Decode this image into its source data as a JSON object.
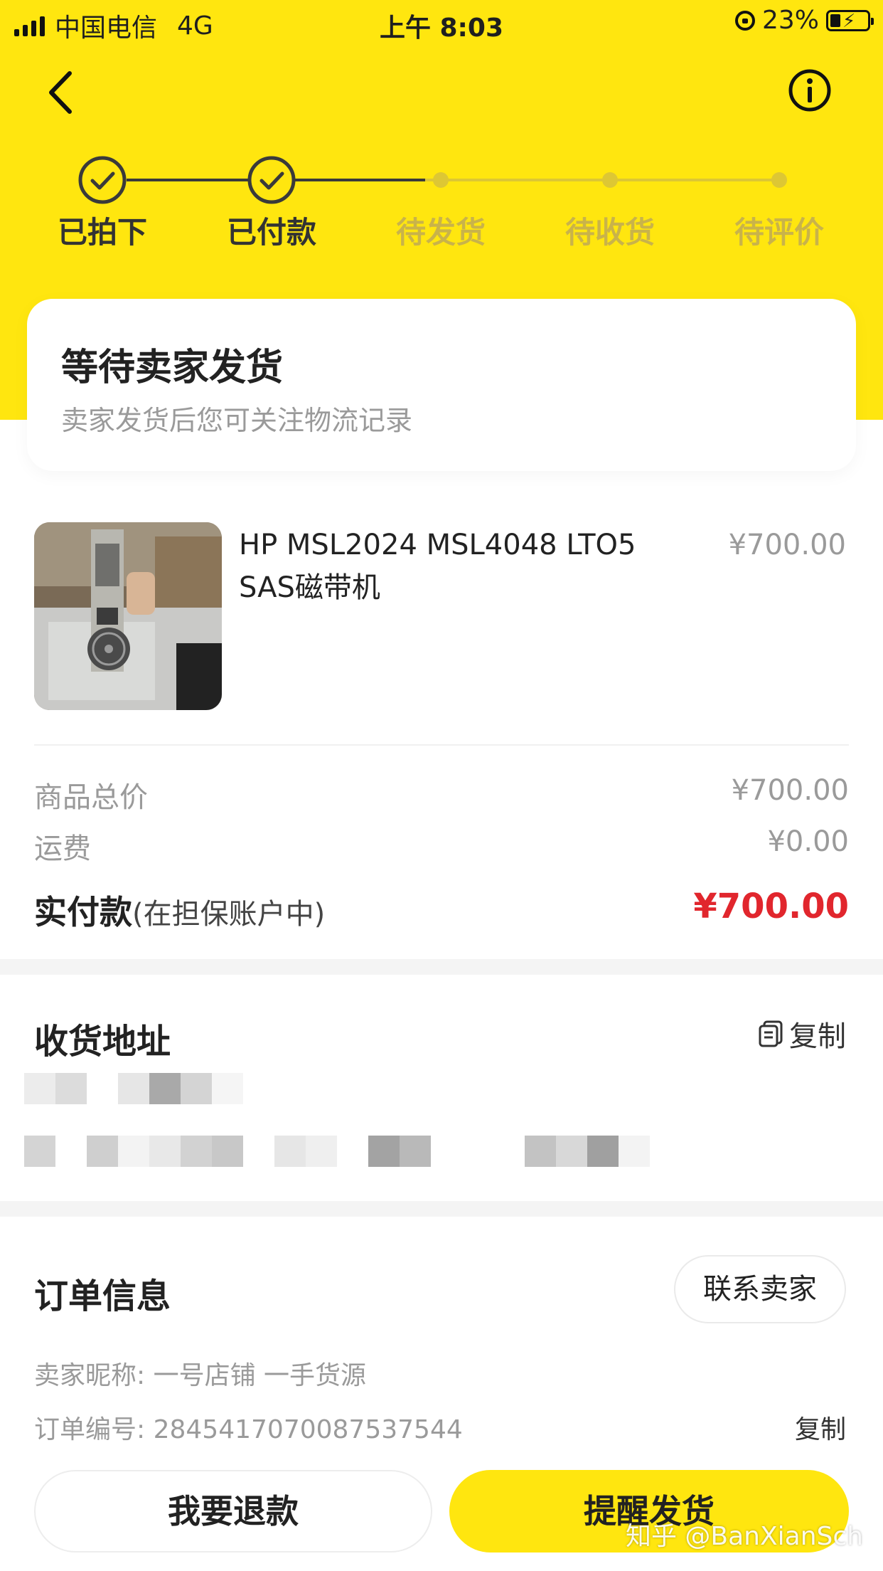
{
  "status_bar": {
    "carrier": "中国电信",
    "network": "4G",
    "time": "上午 8:03",
    "battery": "23%"
  },
  "nav": {
    "back_icon": "back-chevron-icon",
    "info_icon": "info-icon"
  },
  "progress": {
    "steps": [
      {
        "label": "已拍下",
        "done": true
      },
      {
        "label": "已付款",
        "done": true
      },
      {
        "label": "待发货",
        "done": false
      },
      {
        "label": "待收货",
        "done": false
      },
      {
        "label": "待评价",
        "done": false
      }
    ]
  },
  "status_card": {
    "title": "等待卖家发货",
    "subtitle": "卖家发货后您可关注物流记录"
  },
  "product": {
    "title": "HP MSL2024 MSL4048 LTO5 SAS磁带机",
    "price": "¥700.00"
  },
  "summary": {
    "goods_total_label": "商品总价",
    "goods_total_value": "¥700.00",
    "shipping_label": "运费",
    "shipping_value": "¥0.00",
    "paid_label": "实付款",
    "paid_note": "(在担保账户中)",
    "paid_value": "¥700.00"
  },
  "address": {
    "title": "收货地址",
    "copy_label": "复制"
  },
  "order_info": {
    "title": "订单信息",
    "contact_label": "联系卖家",
    "seller_label": "卖家昵称: ",
    "seller_value": "一号店铺 一手货源",
    "order_no_label": "订单编号: ",
    "order_no_value": "2845417070087537544",
    "copy_label": "复制"
  },
  "actions": {
    "refund_label": "我要退款",
    "remind_label": "提醒发货"
  },
  "watermark": "知乎 @BanXianSch",
  "colors": {
    "brand_yellow": "#ffe60f",
    "price_red": "#e1262d"
  }
}
